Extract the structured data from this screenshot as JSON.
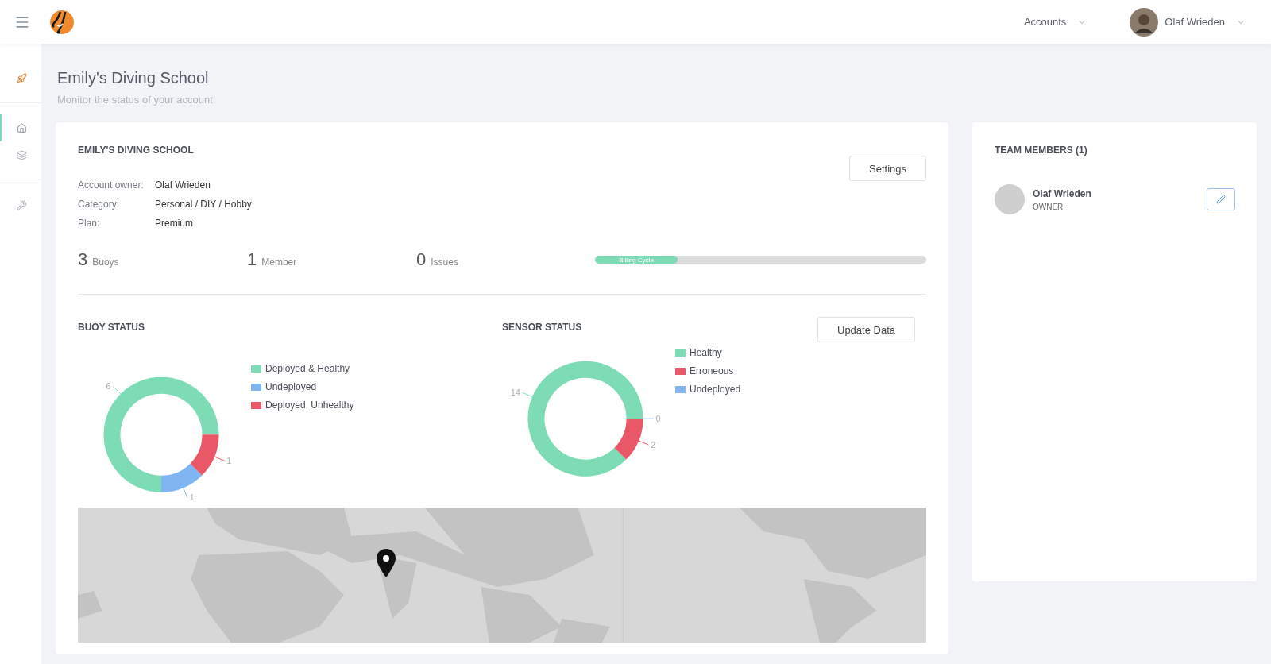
{
  "header": {
    "accounts_menu": "Accounts",
    "user_menu": "Olaf Wrieden"
  },
  "sidebar": {
    "items": [
      {
        "kind": "rocket",
        "selected": false
      },
      {
        "kind": "home",
        "selected": true
      },
      {
        "kind": "layers",
        "selected": false
      },
      {
        "kind": "tools",
        "selected": false
      }
    ]
  },
  "page": {
    "title": "Emily's Diving School",
    "subtitle": "Monitor the status of your account"
  },
  "account": {
    "heading": "EMILY'S DIVING SCHOOL",
    "settings_button": "Settings",
    "details": [
      {
        "label": "Account owner:",
        "value": "Olaf Wrieden"
      },
      {
        "label": "Category:",
        "value": "Personal / DIY / Hobby"
      },
      {
        "label": "Plan:",
        "value": "Premium"
      }
    ],
    "stats": [
      {
        "value": "3",
        "label": "Buoys"
      },
      {
        "value": "1",
        "label": "Member"
      },
      {
        "value": "0",
        "label": "Issues"
      }
    ],
    "billing_cycle": {
      "label": "Billing Cycle",
      "level": 0.25
    }
  },
  "buoy_status": {
    "heading": "BUOY STATUS",
    "chart_data": {
      "type": "donut",
      "categories": [
        "Deployed & Healthy",
        "Undeployed",
        "Deployed, Unhealthy"
      ],
      "values": [
        6,
        1,
        1
      ],
      "colors": [
        "#7ddcb5",
        "#7fb6f2",
        "#ea5766"
      ],
      "value_labels": [
        "6",
        "1",
        "1"
      ]
    }
  },
  "sensor_status": {
    "heading": "SENSOR STATUS",
    "update_button": "Update Data",
    "chart_data": {
      "type": "donut",
      "categories": [
        "Healthy",
        "Erroneous",
        "Undeployed"
      ],
      "values": [
        14,
        2,
        0
      ],
      "colors": [
        "#7ddcb5",
        "#ea5766",
        "#7fb6f2"
      ],
      "value_labels": [
        "14",
        "2",
        "0"
      ]
    }
  },
  "team": {
    "heading": "TEAM MEMBERS (1)",
    "members": [
      {
        "name": "Olaf Wrieden",
        "role": "OWNER"
      }
    ]
  }
}
